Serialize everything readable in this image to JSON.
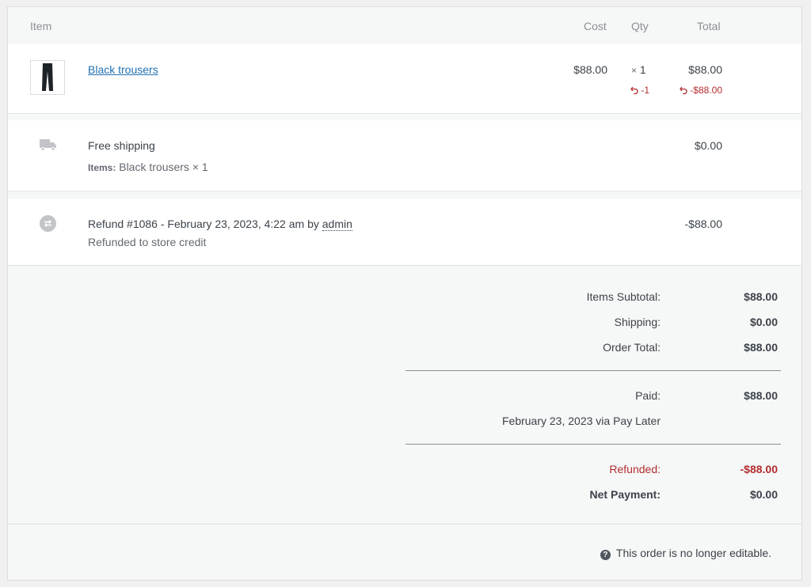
{
  "table": {
    "headers": {
      "item": "Item",
      "cost": "Cost",
      "qty": "Qty",
      "total": "Total"
    }
  },
  "line_item": {
    "name": "Black trousers",
    "cost": "$88.00",
    "qty_prefix": "×",
    "qty": "1",
    "total": "$88.00",
    "refunded_qty": "-1",
    "refunded_total": "-$88.00"
  },
  "shipping": {
    "method": "Free shipping",
    "items_label": "Items:",
    "items_value": "Black trousers × 1",
    "total": "$0.00"
  },
  "refund": {
    "title": "Refund #1086 - February 23, 2023, 4:22 am by",
    "user": "admin",
    "note": "Refunded to store credit",
    "amount": "-$88.00"
  },
  "totals": {
    "items_subtotal_label": "Items Subtotal:",
    "items_subtotal": "$88.00",
    "shipping_label": "Shipping:",
    "shipping": "$0.00",
    "order_total_label": "Order Total:",
    "order_total": "$88.00",
    "paid_label": "Paid:",
    "paid": "$88.00",
    "paid_note": "February 23, 2023 via Pay Later",
    "refunded_label": "Refunded:",
    "refunded": "-$88.00",
    "net_label": "Net Payment:",
    "net": "$0.00"
  },
  "footer": {
    "notice": "This order is no longer editable."
  },
  "colors": {
    "link": "#2271b1",
    "refund_red": "#b32d2e",
    "background": "#f6f7f7"
  },
  "icons": [
    "trousers-thumbnail",
    "refund-undo-icon",
    "truck-icon",
    "refund-icon",
    "help-icon"
  ]
}
